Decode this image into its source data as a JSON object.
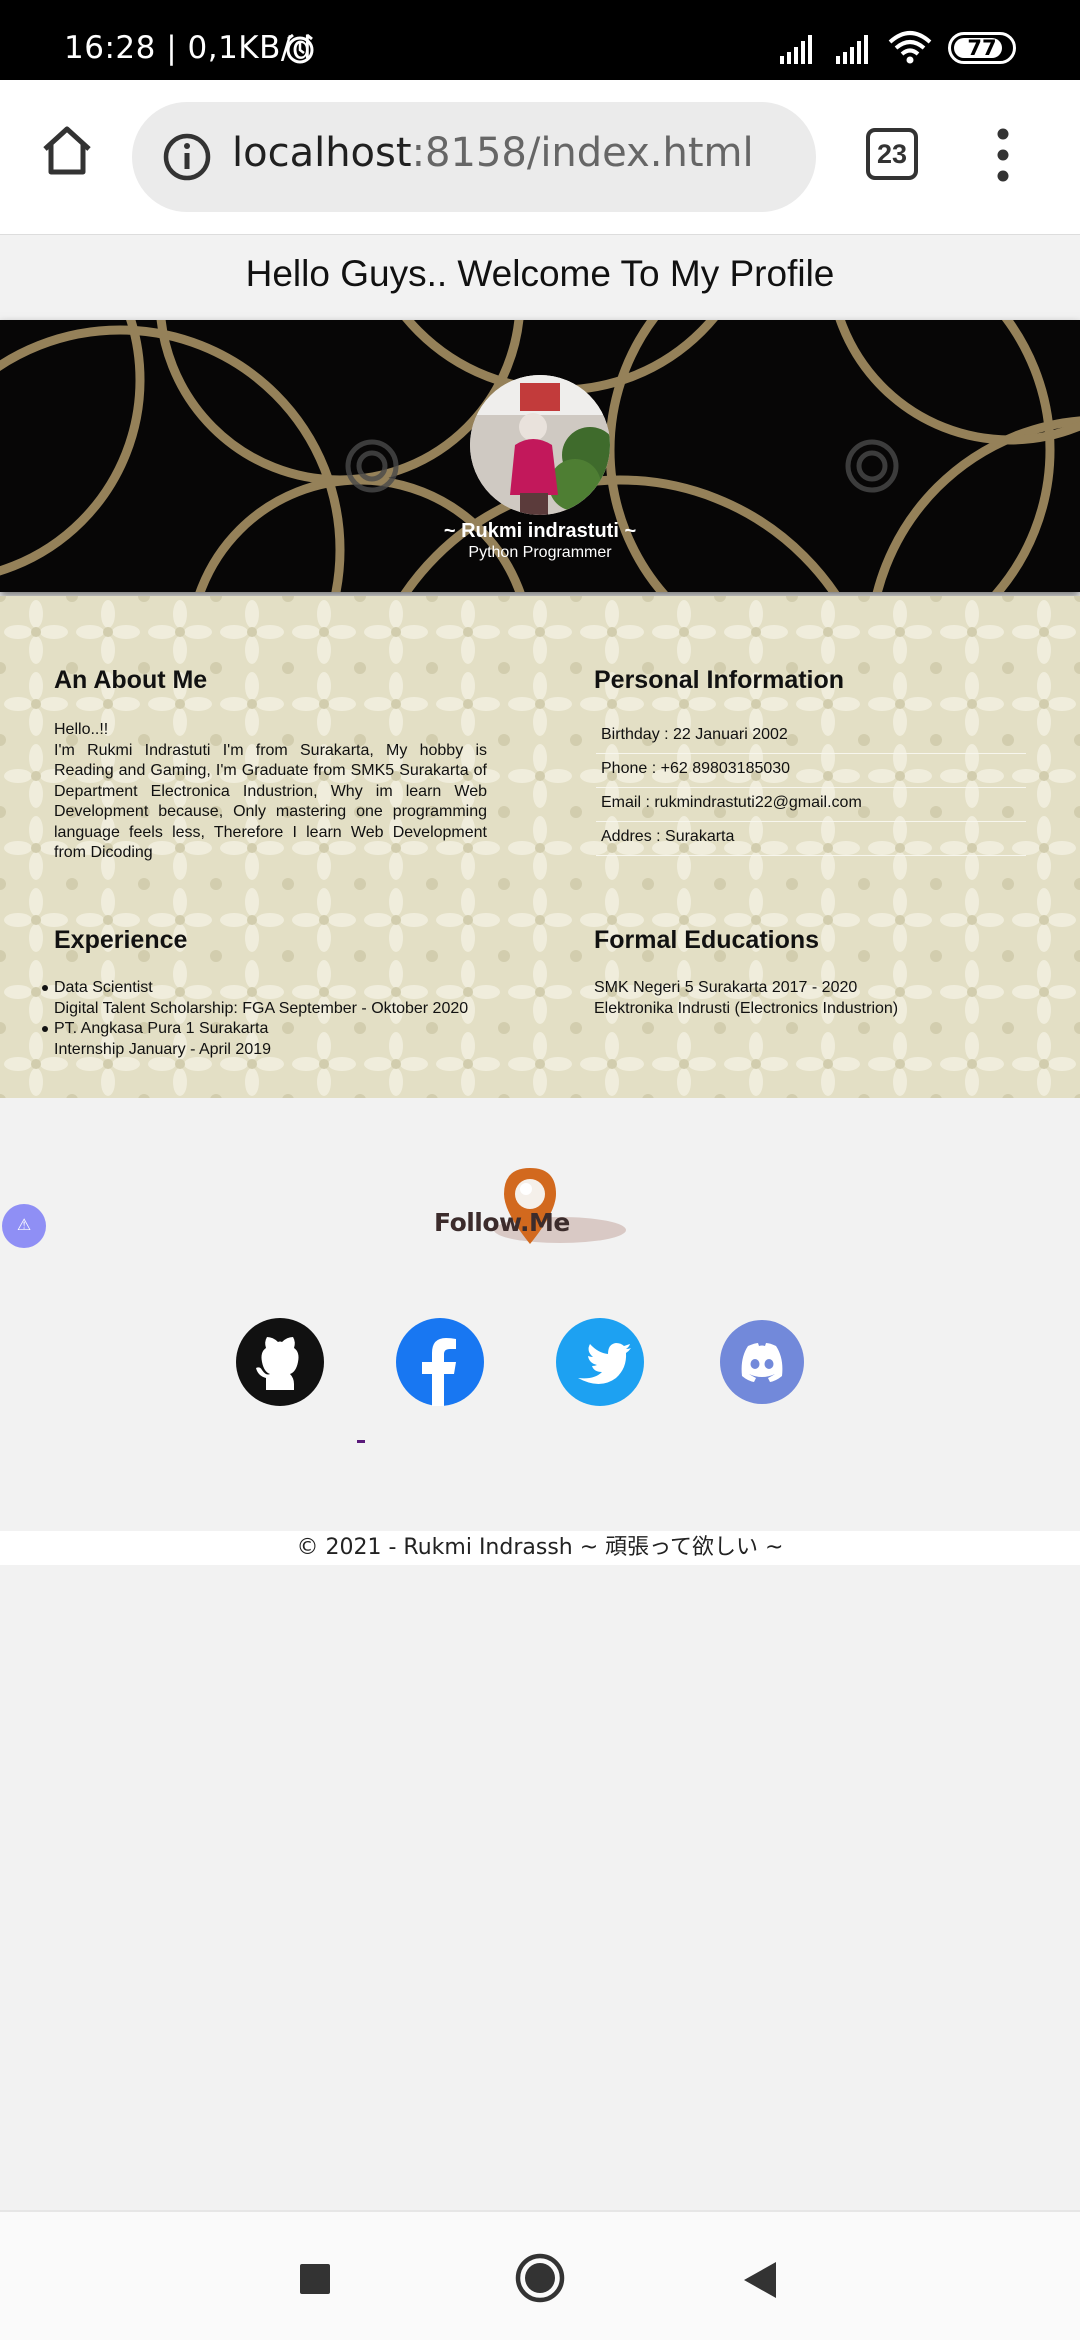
{
  "status_bar": {
    "time_speed": "16:28 | 0,1KB/d",
    "battery_level": "77",
    "icons": [
      "alarm-icon",
      "signal-icon",
      "signal-icon",
      "wifi-icon",
      "battery-icon"
    ]
  },
  "browser": {
    "url_host": "localhost",
    "url_path": ":8158/index.html",
    "tab_count": "23",
    "icons": [
      "home-icon",
      "info-icon",
      "tabs-icon",
      "menu-icon"
    ]
  },
  "page": {
    "title": "Hello Guys.. Welcome To My Profile"
  },
  "hero": {
    "name": "~ Rukmi indrastuti ~",
    "role": "Python Programmer"
  },
  "about": {
    "heading": "An About Me",
    "greeting": "Hello..!!",
    "text": "I'm Rukmi Indrastuti I'm from Surakarta, My hobby is Reading and Gaming, I'm Graduate from SMK5 Surakarta of Department Electronica Industrion, Why im learn Web Development because, Only mastering one programming language feels less, Therefore I learn Web Development from Dicoding"
  },
  "personal_info": {
    "heading": "Personal Information",
    "items": [
      "Birthday : 22 Januari 2002",
      "Phone : +62 89803185030",
      "Email : rukmindrastuti22@gmail.com",
      "Addres : Surakarta"
    ]
  },
  "experience": {
    "heading": "Experience",
    "items": [
      {
        "title": "Data Scientist",
        "detail": "Digital Talent Scholarship: FGA September - Oktober 2020"
      },
      {
        "title": "PT. Angkasa Pura 1 Surakarta",
        "detail": "Internship January - April 2019"
      }
    ]
  },
  "education": {
    "heading": "Formal Educations",
    "lines": [
      "SMK Negeri 5 Surakarta 2017 - 2020",
      "Elektronika Indrusti (Electronics Industrion)"
    ]
  },
  "follow": {
    "logo_text": "Follow.Me",
    "warning_symbol": "⚠",
    "socials": [
      "github-icon",
      "facebook-icon",
      "twitter-icon",
      "discord-icon"
    ]
  },
  "footer": {
    "text": "© 2021 - Rukmi Indrassh ~ 頑張って欲しい ~"
  },
  "colors": {
    "hero_bg": "#070606",
    "hero_lines": "#a58f62",
    "content_bg": "#e3dfc5",
    "facebook": "#1877f2",
    "twitter": "#1da1f2",
    "discord": "#7289da",
    "follow_pin": "#d2691e"
  }
}
